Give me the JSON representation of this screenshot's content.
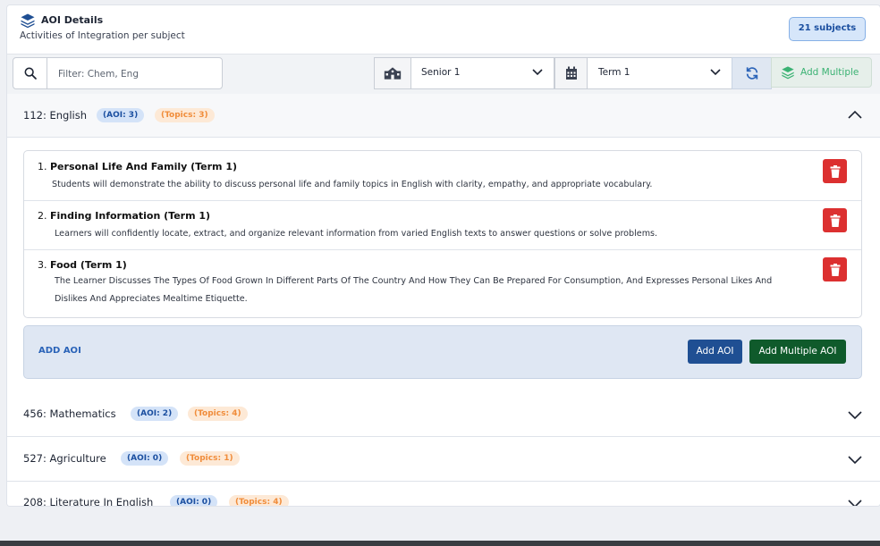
{
  "header": {
    "title": "AOI Details",
    "subtitle": "Activities of Integration per subject",
    "subjects_badge": "21 subjects"
  },
  "toolbar": {
    "search_placeholder": "Filter: Chem, Eng",
    "class_value": "Senior 1",
    "term_value": "Term 1",
    "add_multiple_label": "Add Multiple"
  },
  "subjects": [
    {
      "title": "112: English",
      "aoi": "(AOI: 3)",
      "topics": "(Topics: 3)",
      "expanded": true
    },
    {
      "title": "456: Mathematics",
      "aoi": "(AOI: 2)",
      "topics": "(Topics: 4)",
      "expanded": false
    },
    {
      "title": "527: Agriculture",
      "aoi": "(AOI: 0)",
      "topics": "(Topics: 1)",
      "expanded": false
    },
    {
      "title": "208: Literature In English",
      "aoi": "(AOI: 0)",
      "topics": "(Topics: 4)",
      "expanded": false
    }
  ],
  "aois": [
    {
      "num": "1.",
      "title": "Personal Life And Family (Term 1)",
      "desc": "Students will demonstrate the ability to discuss personal life and family topics in English with clarity, empathy, and appropriate vocabulary."
    },
    {
      "num": "2.",
      "title": "Finding Information (Term 1)",
      "desc": "Learners will confidently locate, extract, and organize relevant information from varied English texts to answer questions or solve problems."
    },
    {
      "num": "3.",
      "title": "Food (Term 1)",
      "desc_line1": "The Learner Discusses The Types Of Food Grown In Different Parts Of The Country And How They Can Be Prepared For Consumption, And Expresses Personal Likes And",
      "desc_line2": "Dislikes And Appreciates Mealtime Etiquette."
    }
  ],
  "aoi_footer": {
    "label": "ADD AOI",
    "add_button": "Add AOI",
    "add_multiple_button": "Add Multiple AOI"
  },
  "colors": {
    "accent_blue": "#1f4f93",
    "success_green": "#0f5a2b",
    "danger_red": "#dc3030",
    "aoi_pill_text": "#1b4fa0",
    "topics_pill_text": "#f08c3a"
  },
  "icons": {
    "header": "layers-icon",
    "search": "search-icon",
    "class": "school-icon",
    "term": "calendar-icon",
    "refresh": "refresh-icon",
    "add_multiple": "layers-icon",
    "delete": "trash-icon",
    "expand": "chevron-down-icon",
    "collapse": "chevron-up-icon"
  }
}
